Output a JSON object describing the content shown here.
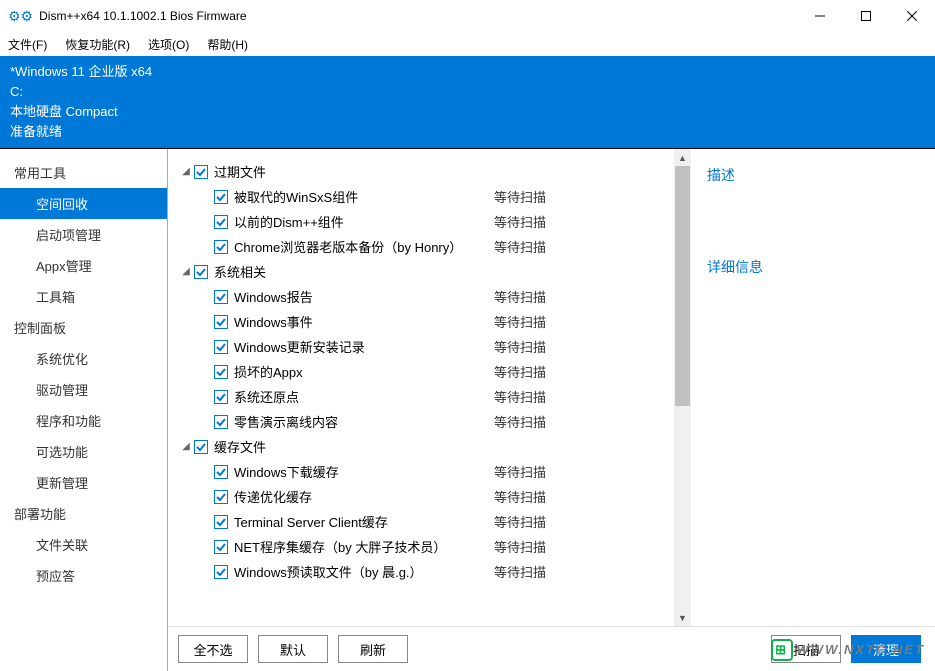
{
  "titlebar": {
    "title": "Dism++x64 10.1.1002.1 Bios Firmware"
  },
  "menu": {
    "items": [
      "文件(F)",
      "恢复功能(R)",
      "选项(O)",
      "帮助(H)"
    ]
  },
  "banner": {
    "line1": "*Windows 11 企业版 x64",
    "line2": "C:",
    "line3": "本地硬盘 Compact",
    "line4": "准备就绪"
  },
  "sidebar": {
    "groups": [
      {
        "header": "常用工具",
        "items": [
          {
            "label": "空间回收",
            "active": true
          },
          {
            "label": "启动项管理"
          },
          {
            "label": "Appx管理"
          },
          {
            "label": "工具箱"
          }
        ]
      },
      {
        "header": "控制面板",
        "items": [
          {
            "label": "系统优化"
          },
          {
            "label": "驱动管理"
          },
          {
            "label": "程序和功能"
          },
          {
            "label": "可选功能"
          },
          {
            "label": "更新管理"
          }
        ]
      },
      {
        "header": "部署功能",
        "items": [
          {
            "label": "文件关联"
          },
          {
            "label": "预应答"
          }
        ]
      }
    ]
  },
  "cleanlist": {
    "status_pending": "等待扫描",
    "groups": [
      {
        "name": "过期文件",
        "items": [
          {
            "label": "被取代的WinSxS组件"
          },
          {
            "label": "以前的Dism++组件"
          },
          {
            "label": "Chrome浏览器老版本备份（by Honry）"
          }
        ]
      },
      {
        "name": "系统相关",
        "items": [
          {
            "label": "Windows报告"
          },
          {
            "label": "Windows事件"
          },
          {
            "label": "Windows更新安装记录"
          },
          {
            "label": "损坏的Appx"
          },
          {
            "label": "系统还原点"
          },
          {
            "label": "零售演示离线内容"
          }
        ]
      },
      {
        "name": "缓存文件",
        "items": [
          {
            "label": "Windows下载缓存"
          },
          {
            "label": "传递优化缓存"
          },
          {
            "label": "Terminal Server Client缓存"
          },
          {
            "label": "NET程序集缓存（by 大胖子技术员）"
          },
          {
            "label": "Windows预读取文件（by 晨.g.）"
          }
        ]
      }
    ]
  },
  "rightpane": {
    "desc_label": "描述",
    "detail_label": "详细信息"
  },
  "buttons": {
    "none": "全不选",
    "default": "默认",
    "refresh": "刷新",
    "scan": "扫描",
    "clean": "清理"
  },
  "watermark": {
    "text": "WWW.NXTC.NET"
  }
}
